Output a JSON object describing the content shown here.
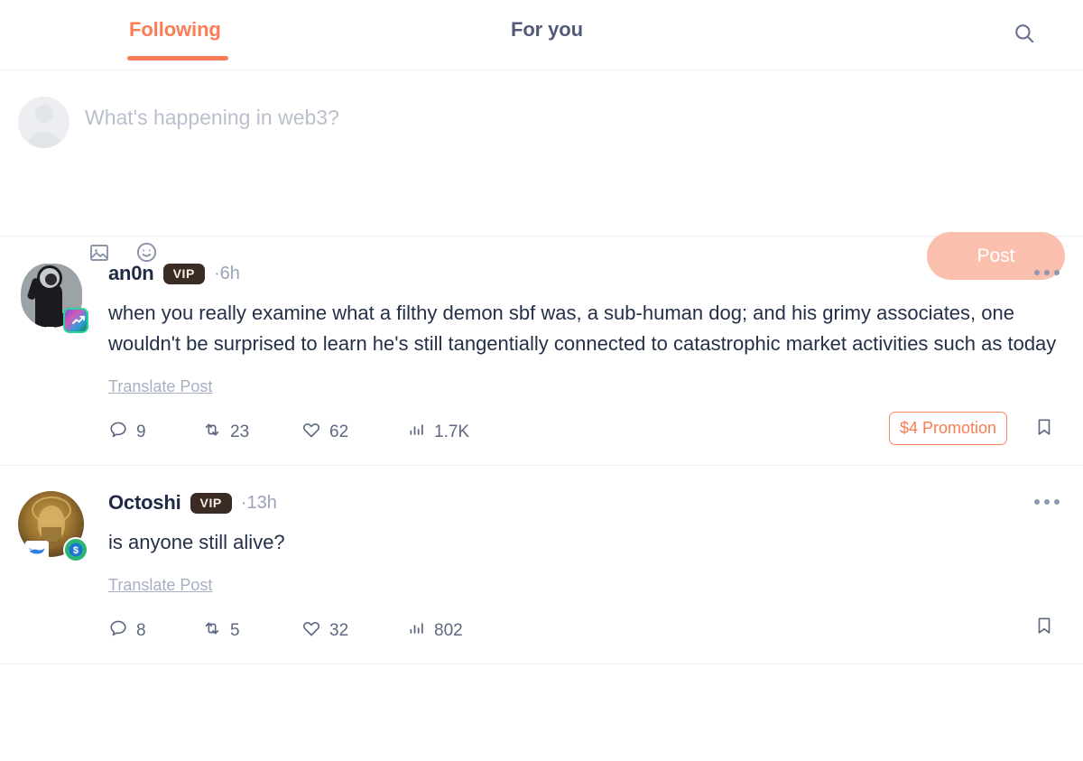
{
  "tabs": {
    "following": "Following",
    "for_you": "For you",
    "active": "Following",
    "accent_color": "#fb7c55",
    "inactive_color": "#515a77",
    "search_icon": "search-icon"
  },
  "composer": {
    "placeholder": "What's happening in web3?",
    "value": "",
    "post_label": "Post",
    "post_button_color": "#fbc0ad",
    "tools": [
      {
        "icon": "image-icon",
        "name": "add-image"
      },
      {
        "icon": "emoji-icon",
        "name": "add-emoji"
      }
    ]
  },
  "feed": [
    {
      "author": "an0n",
      "badge": "VIP",
      "time": "6h",
      "separator": "·",
      "text": "when you really examine what a filthy demon sbf was, a sub-human dog; and his grimy associates, one wouldn't be surprised to learn he's  still tangentially connected to catastrophic market activities such as today",
      "translate_label": "Translate Post",
      "avatar_style": "anon",
      "avatar_badges": [
        "chart-badge"
      ],
      "stats": {
        "replies": "9",
        "reposts": "23",
        "likes": "62",
        "views": "1.7K"
      },
      "promotion": "$4 Promotion",
      "has_promotion": true,
      "more_label": "More options",
      "bookmark_label": "Bookmark"
    },
    {
      "author": "Octoshi",
      "badge": "VIP",
      "time": "13h",
      "separator": "·",
      "text": "is anyone still alive?",
      "translate_label": "Translate Post",
      "avatar_style": "octoshi",
      "avatar_badges": [
        "whale-badge",
        "dollar-badge"
      ],
      "stats": {
        "replies": "8",
        "reposts": "5",
        "likes": "32",
        "views": "802"
      },
      "promotion": "",
      "has_promotion": false,
      "more_label": "More options",
      "bookmark_label": "Bookmark"
    }
  ]
}
